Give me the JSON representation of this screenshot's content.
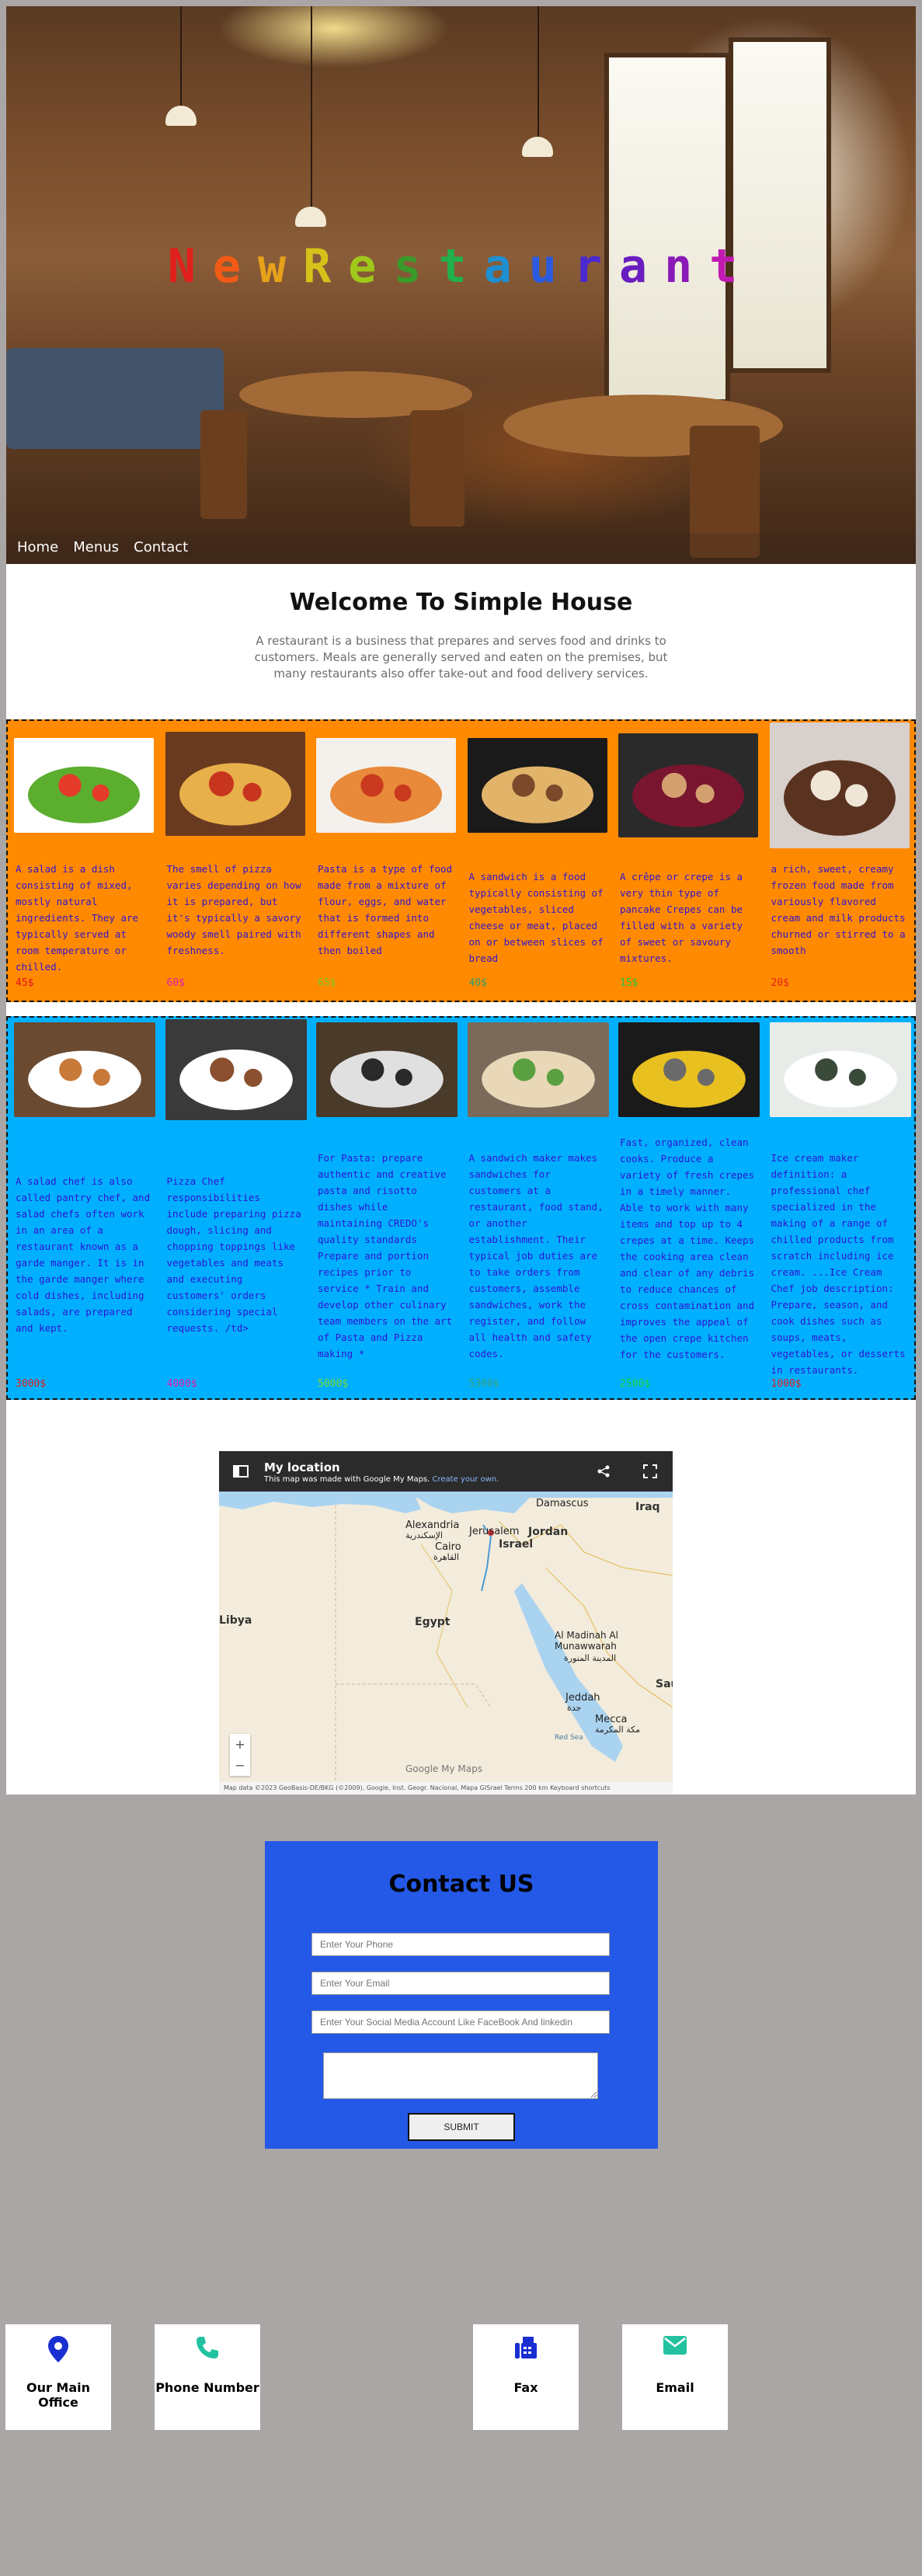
{
  "hero": {
    "title_letters": [
      {
        "ch": "N",
        "color": "#e0201c"
      },
      {
        "ch": "e",
        "color": "#f25a16"
      },
      {
        "ch": "w",
        "color": "#e8a21a"
      },
      {
        "ch": "R",
        "color": "#d4c21a"
      },
      {
        "ch": "e",
        "color": "#a0c81a"
      },
      {
        "ch": "s",
        "color": "#3a9a2a"
      },
      {
        "ch": "t",
        "color": "#22b04a"
      },
      {
        "ch": "a",
        "color": "#1e8fd0"
      },
      {
        "ch": "u",
        "color": "#2a5ae0"
      },
      {
        "ch": "r",
        "color": "#4a2ad0"
      },
      {
        "ch": "a",
        "color": "#6a1ec0"
      },
      {
        "ch": "n",
        "color": "#8a1ab8"
      },
      {
        "ch": "t",
        "color": "#c01ab0"
      }
    ]
  },
  "nav": {
    "items": [
      "Home",
      "Menus",
      "Contact"
    ]
  },
  "welcome": {
    "title": "Welcome To Simple House",
    "text": "A restaurant is a business that prepares and serves food and drinks to customers. Meals are generally served and eaten on the premises, but many restaurants also offer take-out and food delivery services."
  },
  "menu_items": [
    {
      "name": "salad",
      "description": "A salad is a dish consisting of mixed, mostly natural ingredients. They are typically served at room temperature or chilled.",
      "price": "45$",
      "price_color": "#e0101c"
    },
    {
      "name": "pizza",
      "description": "The smell of pizza varies depending on how it is prepared, but it's typically a savory woody smell paired with freshness.",
      "price": "60$",
      "price_color": "#e01caa"
    },
    {
      "name": "pasta",
      "description": "Pasta is a type of food made from a mixture of flour, eggs, and water that is formed into different shapes and then boiled",
      "price": "65$",
      "price_color": "#7ec82a"
    },
    {
      "name": "sandwich",
      "description": "A sandwich is a food typically consisting of vegetables, sliced cheese or meat, placed on or between slices of bread",
      "price": "40$",
      "price_color": "#2aa06a"
    },
    {
      "name": "crepe",
      "description": "A crêpe or crepe is a very thin type of pancake Crepes can be filled with a variety of sweet or savoury mixtures.",
      "price": "15$",
      "price_color": "#1ec83c"
    },
    {
      "name": "ice-cream",
      "description": "a rich, sweet, creamy frozen food made from variously flavored cream and milk products churned or stirred to a smooth",
      "price": "20$",
      "price_color": "#e0201c"
    }
  ],
  "chefs": [
    {
      "name": "salad-chef",
      "description": "A salad chef is also called pantry chef, and salad chefs often work in an area of a restaurant known as a garde manger. It is in the garde manger where cold dishes, including salads, are prepared and kept.",
      "salary": "3000$",
      "salary_color": "#e0201c"
    },
    {
      "name": "pizza-chef",
      "description": "Pizza Chef responsibilities include preparing pizza dough, slicing and chopping toppings like vegetables and meats and executing customers' orders considering special requests. /td>",
      "salary": "4000$",
      "salary_color": "#e01caa"
    },
    {
      "name": "pasta-chef",
      "description": "For Pasta: prepare authentic and creative pasta and risotto dishes while maintaining CREDO's quality standards Prepare and portion recipes prior to service * Train and develop other culinary team members on the art of Pasta and Pizza making *",
      "salary": "5000$",
      "salary_color": "#7ed82a"
    },
    {
      "name": "sandwich-maker",
      "description": "A sandwich maker makes sandwiches for customers at a restaurant, food stand, or another establishment. Their typical job duties are to take orders from customers, assemble sandwiches, work the register, and follow all health and safety codes.",
      "salary": "5300$",
      "salary_color": "#3aa07a"
    },
    {
      "name": "crepe-cook",
      "description": "Fast, organized, clean cooks. Produce a variety of fresh crepes in a timely manner. Able to work with many items and top up to 4 crepes at a time. Keeps the cooking area clean and clear of any debris to reduce chances of cross contamination and improves the appeal of the open crepe kitchen for the customers.",
      "salary": "2500$",
      "salary_color": "#1ed83c"
    },
    {
      "name": "ice-cream-chef",
      "description": "Ice cream maker definition: a professional chef specialized in the making of a range of chilled products from scratch including ice cream. ...Ice Cream Chef job description: Prepare, season, and cook dishes such as soups, meats, vegetables, or desserts in restaurants.",
      "salary": "1000$",
      "salary_color": "#e0201c"
    }
  ],
  "map": {
    "title": "My location",
    "subtitle_prefix": "This map was made with Google My Maps.",
    "subtitle_link": "Create your own.",
    "labels": [
      "Damascus",
      "Iraq",
      "Alexandria",
      "الإسكندرية",
      "Jerusalem",
      "Jordan",
      "Cairo",
      "القاهرة",
      "Israel",
      "Libya",
      "Egypt",
      "Al Madinah Al Munawwarah",
      "المدينة المنورة",
      "Saud",
      "Jeddah",
      "جدة",
      "Mecca",
      "مكة المكرمة",
      "Red Sea"
    ],
    "footer": "Map data ©2023 GeoBasis-DE/BKG (©2009), Google, Inst. Geogr. Nacional, Mapa GISrael   Terms   200 km   Keyboard shortcuts",
    "logo": "Google My Maps",
    "zoom_in": "+",
    "zoom_out": "−"
  },
  "contact": {
    "title": "Contact US",
    "phone_placeholder": "Enter Your Phone",
    "email_placeholder": "Enter Your Email",
    "social_placeholder": "Enter Your Social Media Account Like FaceBook And linkedin",
    "submit_label": "SUBMIT"
  },
  "info_cards": [
    {
      "label": "Our Main Office",
      "icon": "location-pin-icon",
      "color": "#1a2fd0"
    },
    {
      "label": "Phone Number",
      "icon": "phone-icon",
      "color": "#22c2a0"
    },
    {
      "label": "Fax",
      "icon": "fax-icon",
      "color": "#1a2fd0"
    },
    {
      "label": "Email",
      "icon": "envelope-icon",
      "color": "#22c2a0"
    }
  ]
}
